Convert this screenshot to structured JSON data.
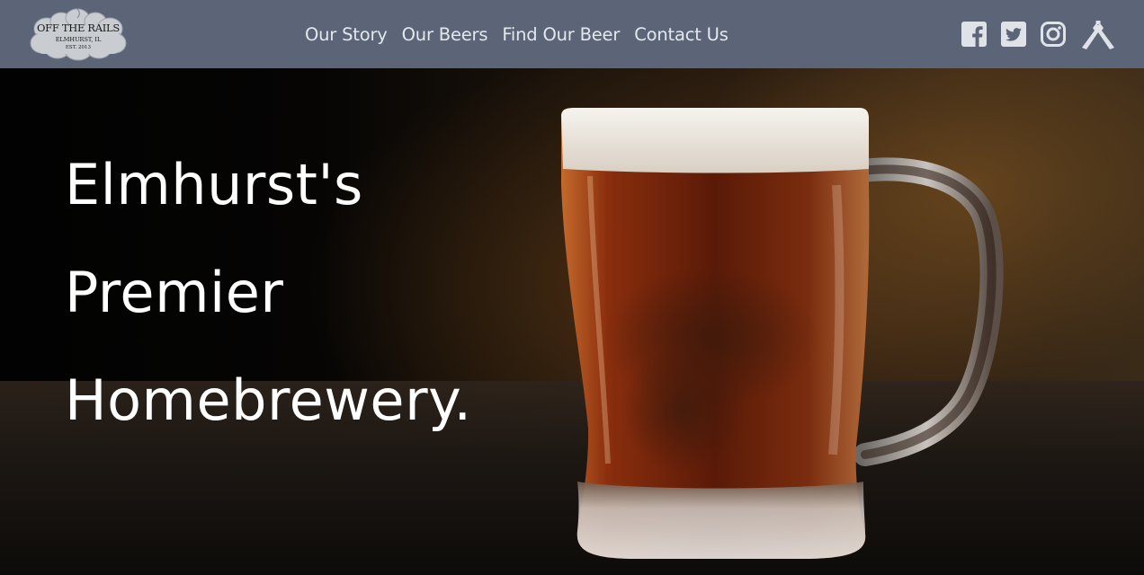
{
  "brand": {
    "name": "OFF THE RAILS",
    "city": "ELMHURST, IL",
    "est": "EST. 2013"
  },
  "nav": {
    "items": [
      {
        "label": "Our Story"
      },
      {
        "label": "Our Beers"
      },
      {
        "label": "Find Our Beer"
      },
      {
        "label": "Contact Us"
      }
    ]
  },
  "social": {
    "icons": [
      "facebook-icon",
      "twitter-icon",
      "instagram-icon",
      "untappd-icon"
    ]
  },
  "hero": {
    "headline": [
      "Elmhurst's",
      "Premier",
      "Homebrewery."
    ]
  },
  "colors": {
    "header_bg": "#5b6577",
    "nav_text": "#e4e7ec",
    "headline_text": "#ffffff",
    "beer": "#8a2e0e",
    "foam": "#f3eee8"
  }
}
